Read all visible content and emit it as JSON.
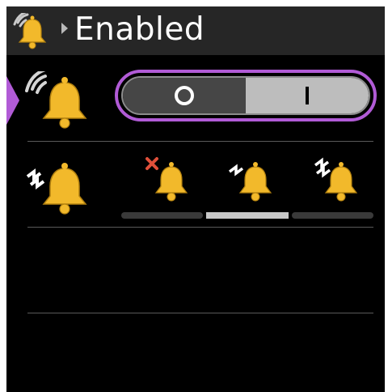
{
  "header": {
    "icon": "bell-ringing-icon",
    "caret": "breadcrumb-caret-icon",
    "title": "Enabled"
  },
  "rows": [
    {
      "name": "sound",
      "icon": "bell-ringing-icon",
      "toggle": {
        "icons": [
          "off-circle-icon",
          "on-bar-icon"
        ],
        "selected_index": 1
      },
      "focused": true
    },
    {
      "name": "vibration",
      "icon": "bell-vibrate-icon",
      "options": [
        "bell-vibrate-off-icon",
        "bell-vibrate-low-icon",
        "bell-vibrate-high-icon"
      ],
      "selected_index": 1
    }
  ],
  "colors": {
    "accent": "#b15bd6",
    "bell": "#f2b92b",
    "cross": "#e0503a",
    "background": "#000000",
    "header_bg": "#262626"
  }
}
